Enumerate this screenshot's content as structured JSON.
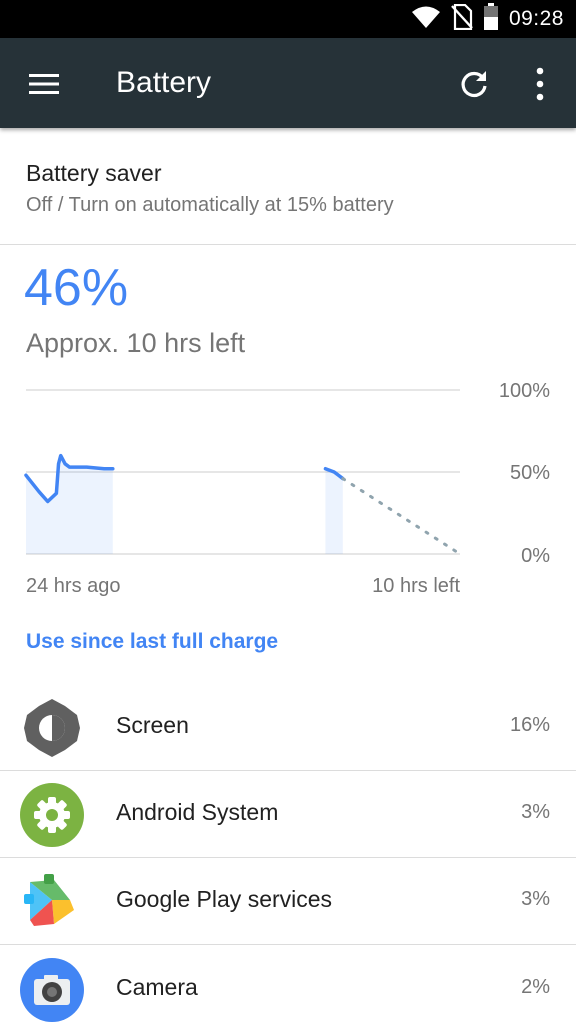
{
  "status_bar": {
    "time": "09:28",
    "icons": [
      "wifi-icon",
      "no-sim-icon",
      "battery-icon"
    ]
  },
  "app_bar": {
    "title": "Battery",
    "icons": [
      "menu-icon",
      "refresh-icon",
      "overflow-menu-icon"
    ],
    "background": "#263238"
  },
  "battery_saver": {
    "title": "Battery saver",
    "summary": "Off / Turn on automatically at 15% battery"
  },
  "battery": {
    "level": "46%",
    "time_left": "Approx. 10 hrs left",
    "accent": "#4285f4"
  },
  "chart": {
    "y_labels": [
      "100%",
      "50%",
      "0%"
    ],
    "x_start_label": "24 hrs ago",
    "x_end_label": "10 hrs left"
  },
  "chart_data": {
    "type": "line",
    "title": "",
    "xlabel": "",
    "ylabel": "",
    "ylim": [
      0,
      100
    ],
    "y_ticks": [
      "100%",
      "50%",
      "0%"
    ],
    "x_labels": [
      "24 hrs ago",
      "10 hrs left"
    ],
    "grid": true,
    "series": [
      {
        "x": [
          0,
          3,
          5,
          7,
          7.5,
          8,
          9,
          10,
          12,
          14,
          18,
          20
        ],
        "values": [
          48,
          38,
          32,
          37,
          55,
          60,
          55,
          53,
          53,
          53,
          52,
          52
        ]
      },
      {
        "x": [
          69,
          71,
          72,
          73
        ],
        "values": [
          52,
          50,
          48,
          46
        ]
      },
      {
        "x": [
          73,
          100
        ],
        "values": [
          46,
          0
        ]
      }
    ]
  },
  "usage_link": "Use since last full charge",
  "apps": [
    {
      "name": "Screen",
      "percent": "16%",
      "icon": "brightness-icon"
    },
    {
      "name": "Android System",
      "percent": "3%",
      "icon": "android-system-gear-icon"
    },
    {
      "name": "Google Play services",
      "percent": "3%",
      "icon": "google-play-services-icon"
    },
    {
      "name": "Camera",
      "percent": "2%",
      "icon": "camera-icon"
    }
  ]
}
